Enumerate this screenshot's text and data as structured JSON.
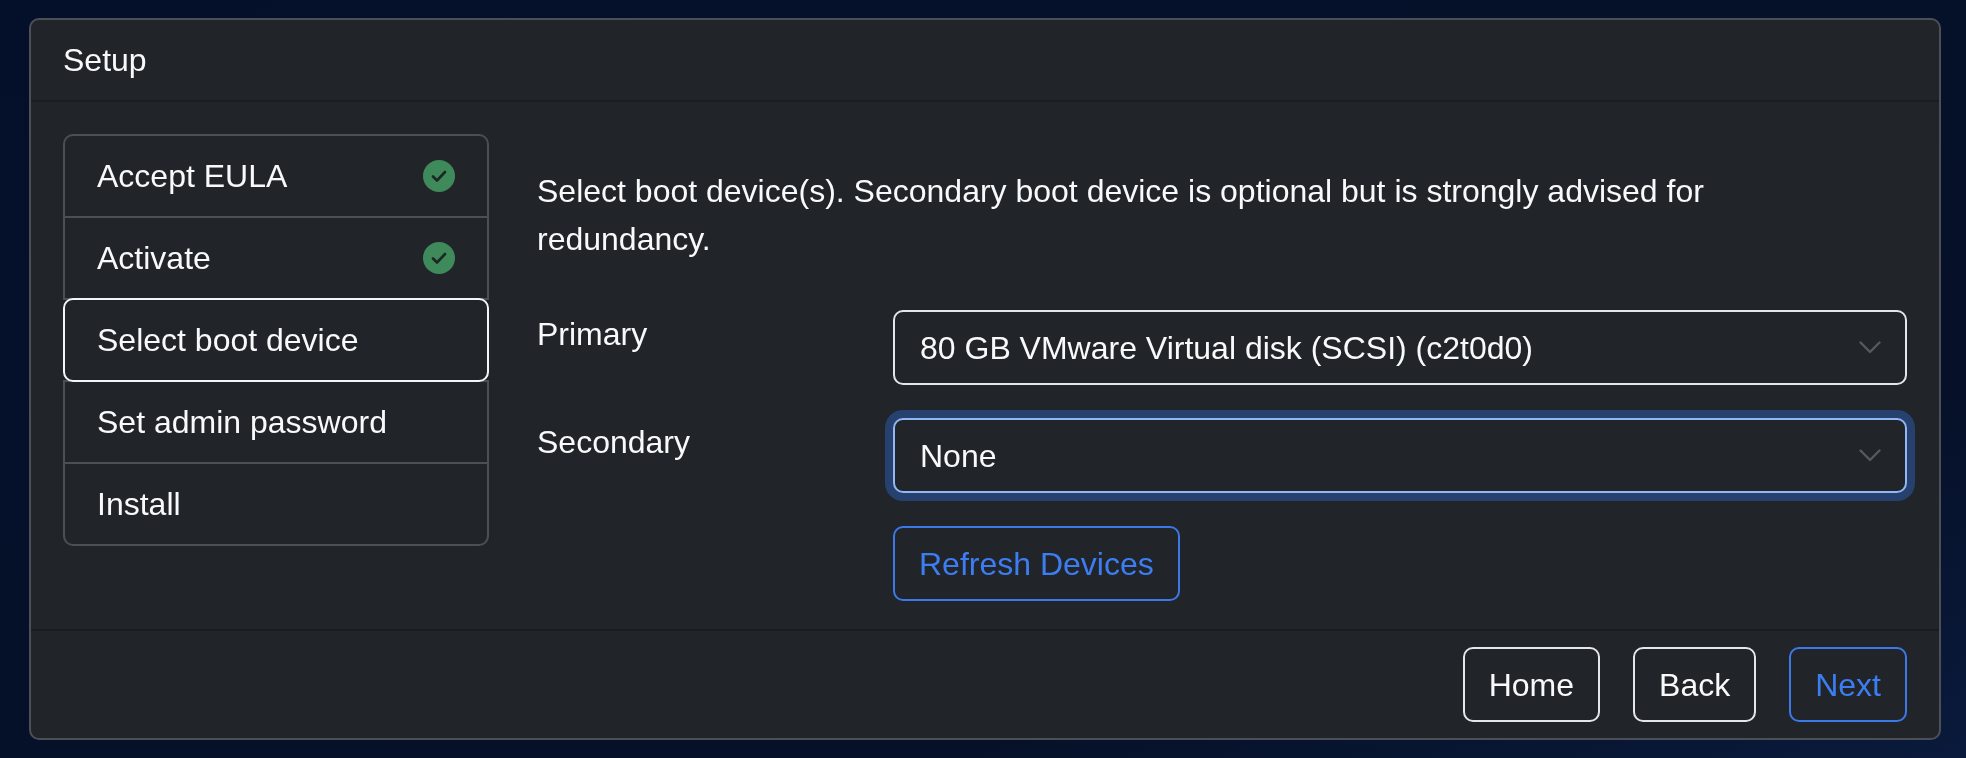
{
  "window": {
    "title": "Setup"
  },
  "steps": [
    {
      "label": "Accept EULA",
      "completed": true,
      "selected": false
    },
    {
      "label": "Activate",
      "completed": true,
      "selected": false
    },
    {
      "label": "Select boot device",
      "completed": false,
      "selected": true
    },
    {
      "label": "Set admin password",
      "completed": false,
      "selected": false
    },
    {
      "label": "Install",
      "completed": false,
      "selected": false
    }
  ],
  "form": {
    "description": "Select boot device(s). Secondary boot device is optional but is strongly advised for redundancy.",
    "fields": [
      {
        "label": "Primary",
        "value": "80 GB VMware Virtual disk (SCSI) (c2t0d0)",
        "focused": false
      },
      {
        "label": "Secondary",
        "value": "None",
        "focused": true
      }
    ],
    "refresh_button": {
      "label": "Refresh Devices",
      "kind": "primary"
    }
  },
  "footer_buttons": [
    {
      "label": "Home",
      "kind": "secondary"
    },
    {
      "label": "Back",
      "kind": "secondary"
    },
    {
      "label": "Next",
      "kind": "primary"
    }
  ]
}
